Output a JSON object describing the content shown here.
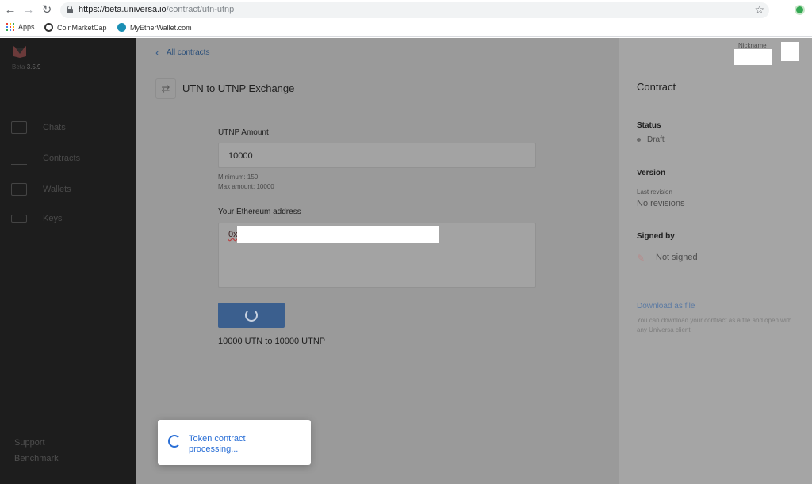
{
  "browser": {
    "url_host": "https://beta.universa.io",
    "url_path": "/contract/utn-utnp",
    "bookmarks": [
      "Apps",
      "CoinMarketCap",
      "MyEtherWallet.com"
    ]
  },
  "sidebar": {
    "beta_label": "Beta",
    "version": "3.5.9",
    "items": [
      {
        "label": "Chats",
        "icon": "chat-icon"
      },
      {
        "label": "Contracts",
        "icon": "signature-icon"
      },
      {
        "label": "Wallets",
        "icon": "wallet-icon"
      },
      {
        "label": "Keys",
        "icon": "key-icon"
      }
    ],
    "support_label": "Support",
    "benchmark_label": "Benchmark"
  },
  "main": {
    "back_label": "All contracts",
    "title": "UTN to UTNP Exchange",
    "amount_label": "UTNP Amount",
    "amount_value": "10000",
    "hint_min": "Minimum: 150",
    "hint_max": "Max amount: 10000",
    "eth_label": "Your Ethereum address",
    "eth_prefix": "0x",
    "summary": "10000 UTN to 10000 UTNP"
  },
  "toast": {
    "message": "Token contract processing..."
  },
  "header": {
    "nickname_label": "Nickname"
  },
  "details": {
    "title": "Contract",
    "status_heading": "Status",
    "status_value": "Draft",
    "version_heading": "Version",
    "version_sub": "Last revision",
    "version_value": "No revisions",
    "signed_heading": "Signed by",
    "signed_value": "Not signed",
    "download_link": "Download as file",
    "download_note": "You can download your contract as a file and open with any Universa client"
  },
  "colors": {
    "sidebar": "#1d1d1d",
    "overlay_main": "#9a9a9a",
    "accent_blue": "#2a6fd6",
    "button": "#3b5f8e"
  }
}
